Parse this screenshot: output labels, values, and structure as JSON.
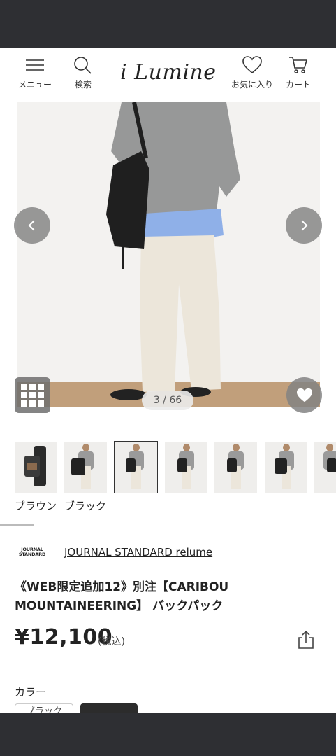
{
  "header": {
    "logo": "i Lumine",
    "menu_label": "メニュー",
    "search_label": "検索",
    "favorites_label": "お気に入り",
    "cart_label": "カート"
  },
  "gallery": {
    "counter": "3 / 66"
  },
  "thumbnails": {
    "selected_index": 2,
    "color_labels": [
      "ブラウン",
      "ブラック"
    ]
  },
  "product": {
    "brand": "JOURNAL STANDARD relume",
    "brand_logo_text": "JOURNAL STANDARD",
    "title": "《WEB限定追加12》別注【CARIBOU MOUNTAINEERING】 バックパック",
    "price": "¥12,100",
    "tax_label": "(税込)"
  },
  "color_section": {
    "heading": "カラー",
    "option_1": "ブラック"
  },
  "colors": {
    "status_bar": "#2e2f33",
    "text": "#222222"
  }
}
